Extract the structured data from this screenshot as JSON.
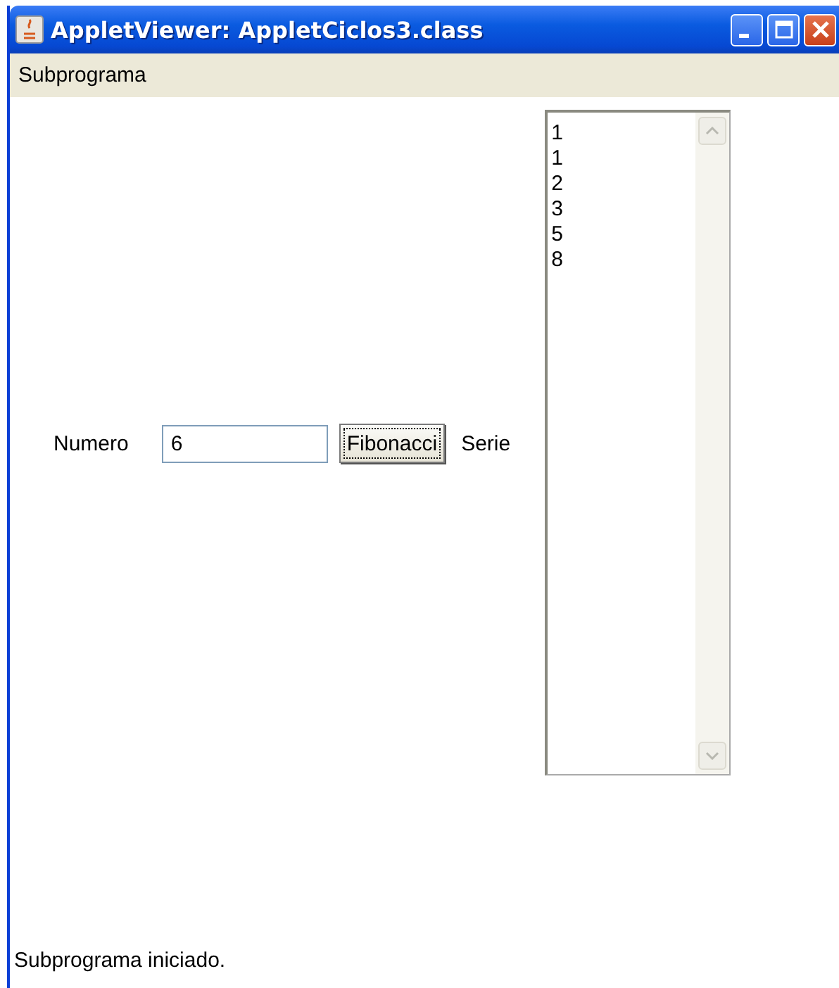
{
  "window": {
    "title": "AppletViewer: AppletCiclos3.class"
  },
  "menu_bar": {
    "items": [
      "Subprograma"
    ]
  },
  "form": {
    "number_label": "Numero",
    "number_field": {
      "value": "6"
    },
    "button": "Fibonacci",
    "series_label": "Serie"
  },
  "series_output": {
    "lines": [
      "1",
      "1",
      "2",
      "3",
      "5",
      "8"
    ]
  },
  "status_bar": "Subprograma iniciado."
}
